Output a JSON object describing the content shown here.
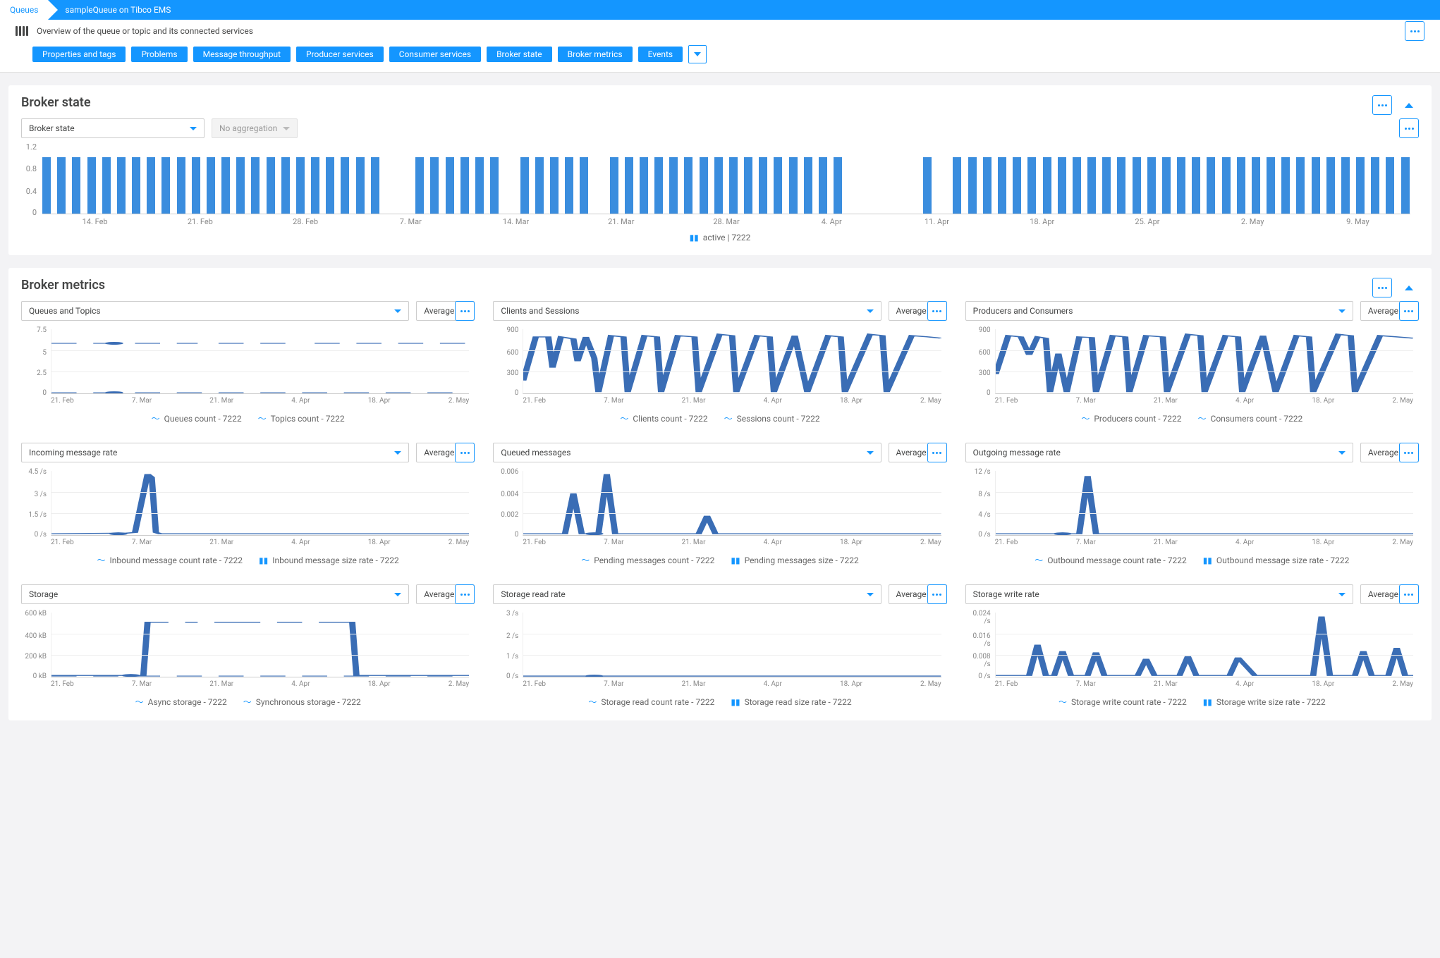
{
  "breadcrumb": {
    "root": "Queues",
    "current": "sampleQueue on Tibco EMS"
  },
  "header": {
    "subtitle": "Overview of the queue or topic and its connected services"
  },
  "pills": [
    "Properties and tags",
    "Problems",
    "Message throughput",
    "Producer services",
    "Consumer services",
    "Broker state",
    "Broker metrics",
    "Events"
  ],
  "broker_state": {
    "title": "Broker state",
    "selector_label": "Broker state",
    "agg_label": "No aggregation",
    "legend": "active | 7222",
    "yticks": [
      "1.2",
      "0.8",
      "0.4",
      "0"
    ],
    "xticks": [
      "14. Feb",
      "21. Feb",
      "28. Feb",
      "7. Mar",
      "14. Mar",
      "21. Mar",
      "28. Mar",
      "4. Apr",
      "11. Apr",
      "18. Apr",
      "25. Apr",
      "2. May",
      "9. May"
    ]
  },
  "broker_metrics": {
    "title": "Broker metrics",
    "agg_default": "Average",
    "xticks": [
      "21. Feb",
      "7. Mar",
      "21. Mar",
      "4. Apr",
      "18. Apr",
      "2. May"
    ],
    "charts": [
      {
        "title": "Queues and Topics",
        "yticks": [
          "7.5",
          "5",
          "2.5",
          "0"
        ],
        "legend": [
          "Queues count - 7222",
          "Topics count - 7222"
        ],
        "legicons": [
          "~",
          "~"
        ]
      },
      {
        "title": "Clients and Sessions",
        "yticks": [
          "900",
          "600",
          "300",
          "0"
        ],
        "legend": [
          "Clients count - 7222",
          "Sessions count - 7222"
        ],
        "legicons": [
          "~",
          "~"
        ]
      },
      {
        "title": "Producers and Consumers",
        "yticks": [
          "900",
          "600",
          "300",
          "0"
        ],
        "legend": [
          "Producers count - 7222",
          "Consumers count - 7222"
        ],
        "legicons": [
          "~",
          "~"
        ]
      },
      {
        "title": "Incoming message rate",
        "yticks": [
          "4.5 /s",
          "3 /s",
          "1.5 /s",
          "0 /s"
        ],
        "legend": [
          "Inbound message count rate - 7222",
          "Inbound message size rate - 7222"
        ],
        "legicons": [
          "~",
          "bar"
        ]
      },
      {
        "title": "Queued messages",
        "yticks": [
          "0.006",
          "0.004",
          "0.002",
          "0"
        ],
        "legend": [
          "Pending messages count - 7222",
          "Pending messages size - 7222"
        ],
        "legicons": [
          "~",
          "bar"
        ]
      },
      {
        "title": "Outgoing message rate",
        "yticks": [
          "12 /s",
          "8 /s",
          "4 /s",
          "0 /s"
        ],
        "legend": [
          "Outbound message count rate - 7222",
          "Outbound message size rate - 7222"
        ],
        "legicons": [
          "~",
          "bar"
        ]
      },
      {
        "title": "Storage",
        "yticks": [
          "600 kB",
          "400 kB",
          "200 kB",
          "0 kB"
        ],
        "legend": [
          "Async storage - 7222",
          "Synchronous storage - 7222"
        ],
        "legicons": [
          "~",
          "~"
        ]
      },
      {
        "title": "Storage read rate",
        "yticks": [
          "3 /s",
          "2 /s",
          "1 /s",
          "0 /s"
        ],
        "legend": [
          "Storage read count rate - 7222",
          "Storage read size rate - 7222"
        ],
        "legicons": [
          "~",
          "bar"
        ]
      },
      {
        "title": "Storage write rate",
        "yticks": [
          "0.024 /s",
          "0.016 /s",
          "0.008 /s",
          "0 /s"
        ],
        "legend": [
          "Storage write count rate - 7222",
          "Storage write size rate - 7222"
        ],
        "legicons": [
          "~",
          "bar"
        ]
      }
    ]
  },
  "chart_data": [
    {
      "type": "bar",
      "title": "Broker state",
      "ylabel": "",
      "ylim": [
        0,
        1.2
      ],
      "series_name": "active | 7222",
      "bars_pattern": "90 bars mostly at value 1.0 representing active state, with gaps (no data) around 7. Mar, 14. Mar, 23. Mar, 5-10. Apr",
      "categories": [
        "14. Feb",
        "21. Feb",
        "28. Feb",
        "7. Mar",
        "14. Mar",
        "21. Mar",
        "28. Mar",
        "4. Apr",
        "11. Apr",
        "18. Apr",
        "25. Apr",
        "2. May",
        "9. May"
      ]
    },
    {
      "type": "line",
      "title": "Queues and Topics",
      "ylim": [
        0,
        7.5
      ],
      "x": [
        "21. Feb",
        "7. Mar",
        "21. Mar",
        "4. Apr",
        "18. Apr",
        "2. May"
      ],
      "series": [
        {
          "name": "Queues count - 7222",
          "values": [
            6,
            6,
            6,
            6,
            6,
            6
          ],
          "style": "dashed, mostly flat around 6 with small gaps"
        },
        {
          "name": "Topics count - 7222",
          "values": [
            0,
            0,
            0,
            0,
            0,
            0
          ],
          "style": "flat near 0, dashed"
        }
      ]
    },
    {
      "type": "line",
      "title": "Clients and Sessions",
      "ylim": [
        0,
        900
      ],
      "x": [
        "21. Feb",
        "7. Mar",
        "21. Mar",
        "4. Apr",
        "18. Apr",
        "2. May"
      ],
      "series": [
        {
          "name": "Clients count - 7222",
          "approx_values": "oscillating between ~0 and ~800, sawtooth pattern with frequent drops to 0"
        },
        {
          "name": "Sessions count - 7222",
          "approx_values": "tracks clients count closely"
        }
      ]
    },
    {
      "type": "line",
      "title": "Producers and Consumers",
      "ylim": [
        0,
        900
      ],
      "x": [
        "21. Feb",
        "7. Mar",
        "21. Mar",
        "4. Apr",
        "18. Apr",
        "2. May"
      ],
      "series": [
        {
          "name": "Producers count - 7222",
          "approx_values": "sawtooth oscillation 0–800"
        },
        {
          "name": "Consumers count - 7222",
          "approx_values": "similar sawtooth 0–800"
        }
      ]
    },
    {
      "type": "line",
      "title": "Incoming message rate",
      "ylabel": "/s",
      "ylim": [
        0,
        4.5
      ],
      "x": [
        "21. Feb",
        "7. Mar",
        "21. Mar",
        "4. Apr",
        "18. Apr",
        "2. May"
      ],
      "series": [
        {
          "name": "Inbound message count rate - 7222",
          "approx_values": "near 0 baseline with single spike to ~4 /s around 7. Mar"
        },
        {
          "name": "Inbound message size rate - 7222",
          "approx_values": "near 0"
        }
      ]
    },
    {
      "type": "line",
      "title": "Queued messages",
      "ylim": [
        0,
        0.006
      ],
      "x": [
        "21. Feb",
        "7. Mar",
        "21. Mar",
        "4. Apr",
        "18. Apr",
        "2. May"
      ],
      "series": [
        {
          "name": "Pending messages count - 7222",
          "approx_values": "baseline 0 with two spikes ~0.004 and ~0.006 between 21 Feb–7 Mar, smaller spike ~0.002 near 21 Mar"
        },
        {
          "name": "Pending messages size - 7222",
          "approx_values": "near 0"
        }
      ]
    },
    {
      "type": "line",
      "title": "Outgoing message rate",
      "ylabel": "/s",
      "ylim": [
        0,
        12
      ],
      "x": [
        "21. Feb",
        "7. Mar",
        "21. Mar",
        "4. Apr",
        "18. Apr",
        "2. May"
      ],
      "series": [
        {
          "name": "Outbound message count rate - 7222",
          "approx_values": "baseline 0, single spike to ~11 /s around 7 Mar"
        },
        {
          "name": "Outbound message size rate - 7222",
          "approx_values": "near 0"
        }
      ]
    },
    {
      "type": "line",
      "title": "Storage",
      "ylabel": "kB",
      "ylim": [
        0,
        600
      ],
      "x": [
        "21. Feb",
        "7. Mar",
        "21. Mar",
        "4. Apr",
        "18. Apr",
        "2. May"
      ],
      "series": [
        {
          "name": "Async storage - 7222",
          "approx_values": "0 until ~7 Mar, step up to ~510 kB plateau until ~22 Apr, then drop to 0"
        },
        {
          "name": "Synchronous storage - 7222",
          "approx_values": "near 0 dashed scatter"
        }
      ]
    },
    {
      "type": "line",
      "title": "Storage read rate",
      "ylabel": "/s",
      "ylim": [
        0,
        3
      ],
      "x": [
        "21. Feb",
        "7. Mar",
        "21. Mar",
        "4. Apr",
        "18. Apr",
        "2. May"
      ],
      "series": [
        {
          "name": "Storage read count rate - 7222",
          "approx_values": "flat at 0"
        },
        {
          "name": "Storage read size rate - 7222",
          "approx_values": "flat at 0"
        }
      ]
    },
    {
      "type": "line",
      "title": "Storage write rate",
      "ylabel": "/s",
      "ylim": [
        0,
        0.024
      ],
      "x": [
        "21. Feb",
        "7. Mar",
        "21. Mar",
        "4. Apr",
        "18. Apr",
        "2. May"
      ],
      "series": [
        {
          "name": "Storage write count rate - 7222",
          "approx_values": "baseline 0 with multiple triangular spikes: ~0.011 near 25 Feb, ~0.009 near 7 Mar, ~0.006 near 14 Mar, ~0.008 near 28 Mar, ~0.007 near 10 Apr, ~0.023 near 24 Apr, ~0.01 near 2 May"
        },
        {
          "name": "Storage write size rate - 7222",
          "approx_values": "near 0"
        }
      ]
    }
  ]
}
